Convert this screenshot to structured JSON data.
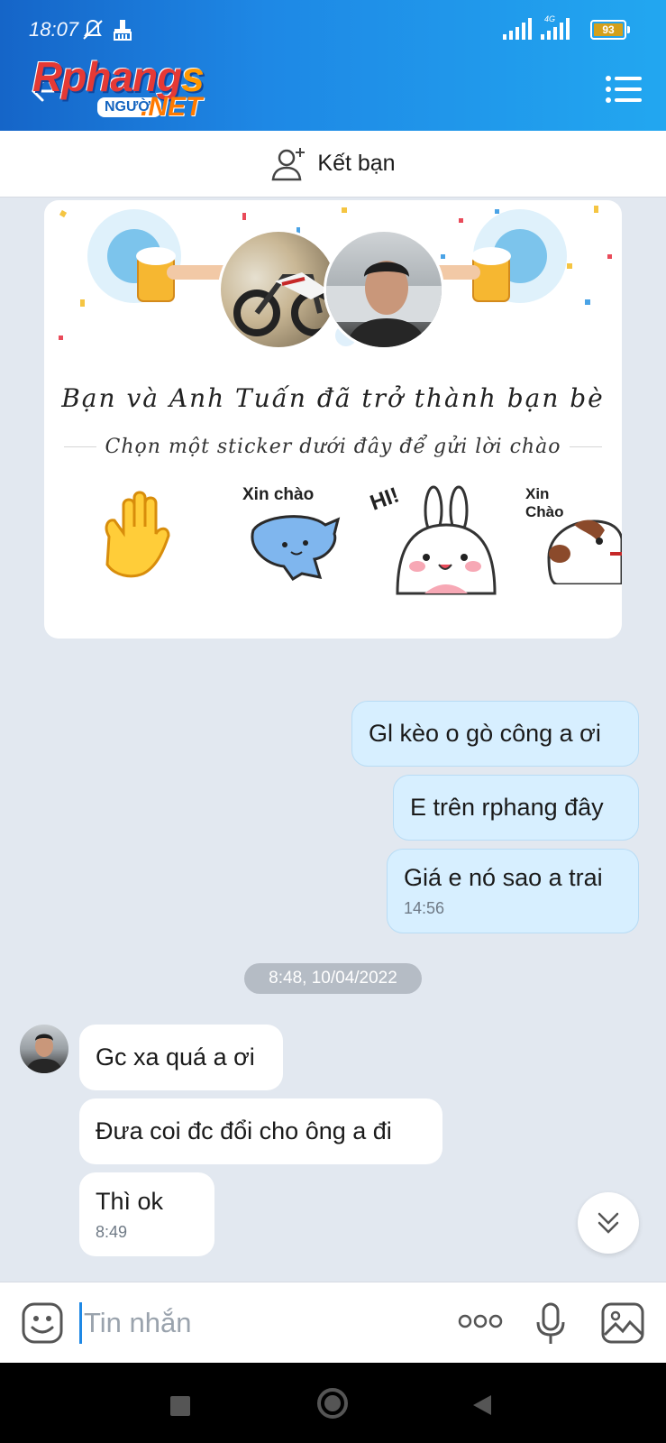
{
  "status_bar": {
    "time": "18:07",
    "network": "4G",
    "battery": "93"
  },
  "header": {
    "logo_main": "Rphang",
    "logo_suffix": "s",
    "logo_badge": "NGƯỜI",
    "logo_net": ".NET"
  },
  "friend_bar": {
    "label": "Kết bạn"
  },
  "friend_card": {
    "title": "Bạn và Anh Tuấn đã trở thành bạn bè",
    "subtitle": "Chọn một sticker dưới đây để gửi lời chào",
    "stickers": [
      {
        "name": "wave-hand",
        "text": ""
      },
      {
        "name": "blue-cat",
        "text": "Xin chào"
      },
      {
        "name": "bunny",
        "text": "HI!"
      },
      {
        "name": "dog",
        "text": "Xin Chào"
      }
    ]
  },
  "messages": {
    "out": [
      {
        "text": "Gl kèo o gò công a ơi"
      },
      {
        "text": "E trên rphang đây"
      },
      {
        "text": "Giá e nó sao a trai",
        "time": "14:56"
      }
    ],
    "date_separator": "8:48, 10/04/2022",
    "in": [
      {
        "text": "Gc xa quá a ơi"
      },
      {
        "text": "Đưa coi đc đổi cho ông a đi"
      },
      {
        "text": "Thì ok",
        "time": "8:49"
      }
    ]
  },
  "composer": {
    "placeholder": "Tin nhắn"
  },
  "colors": {
    "header_start": "#1565c8",
    "header_end": "#22a7f0",
    "outgoing_bubble": "#d7efff",
    "chat_background": "#e2e8f0"
  }
}
